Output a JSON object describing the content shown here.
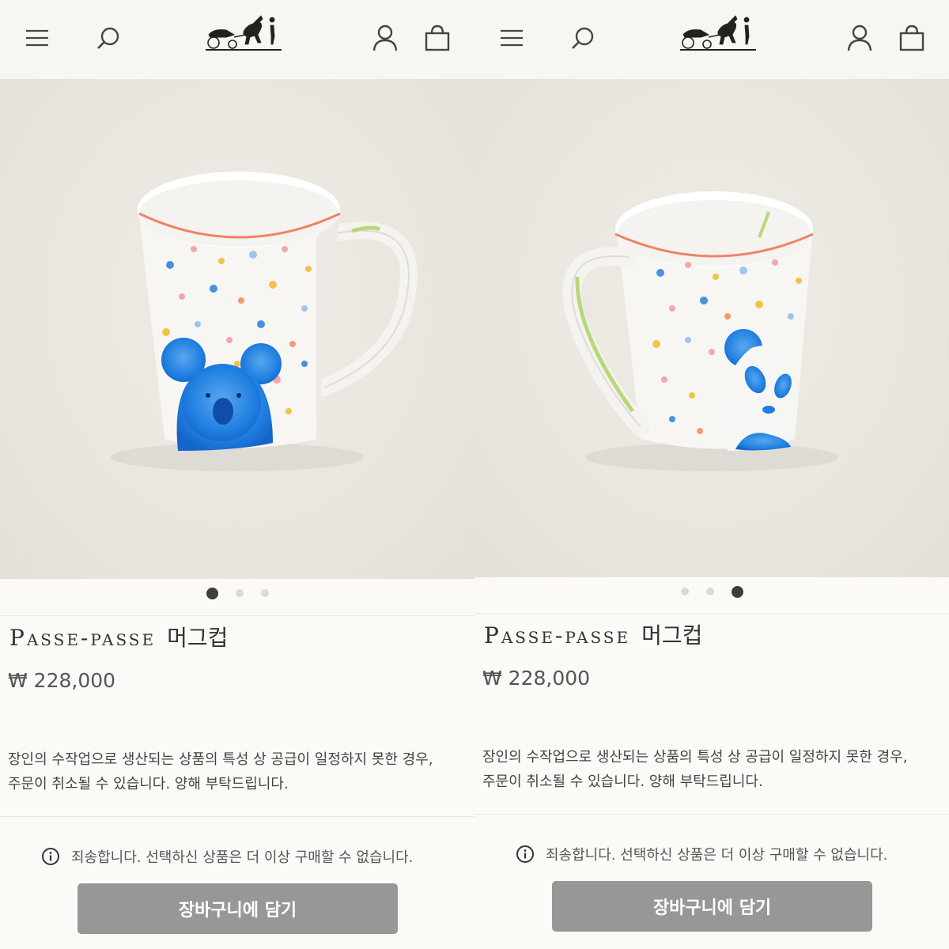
{
  "panels": [
    {
      "id": "left",
      "header": {
        "menu_icon": "hamburger-icon",
        "search_icon": "search-icon",
        "logo": "hermes-carriage-logo",
        "account_icon": "user-icon",
        "bag_icon": "shopping-bag-icon"
      },
      "image": {
        "subject": "koala",
        "dots_count": 3,
        "active_dot": 1
      },
      "product": {
        "title_latin": "Passe-passe",
        "title_korean": "머그컵",
        "price": "₩ 228,000",
        "notice_line1": "장인의 수작업으로 생산되는 상품의 특성 상 공급이 일정하지 못한 경우,",
        "notice_line2": "주문이 취소될 수 있습니다. 양해 부탁드립니다.",
        "soldout_text": "죄송합니다. 선택하신 상품은 더 이상 구매할 수 없습니다.",
        "cart_button": "장바구니에 담기"
      }
    },
    {
      "id": "right",
      "header": {
        "menu_icon": "hamburger-icon",
        "search_icon": "search-icon",
        "logo": "hermes-carriage-logo",
        "account_icon": "user-icon",
        "bag_icon": "shopping-bag-icon"
      },
      "image": {
        "subject": "panda",
        "dots_count": 3,
        "active_dot": 3
      },
      "product": {
        "title_latin": "Passe-passe",
        "title_korean": "머그컵",
        "price": "₩ 228,000",
        "notice_line1": "장인의 수작업으로 생산되는 상품의 특성 상 공급이 일정하지 못한 경우,",
        "notice_line2": "주문이 취소될 수 있습니다. 양해 부탁드립니다.",
        "soldout_text": "죄송합니다. 선택하신 상품은 더 이상 구매할 수 없습니다.",
        "cart_button": "장바구니에 담기"
      }
    }
  ],
  "colors": {
    "background": "#fbfaf6",
    "header": "#f8f6f1",
    "button": "#979797",
    "accent_blue": "#1f7fe0",
    "rim": "#f0826a"
  }
}
